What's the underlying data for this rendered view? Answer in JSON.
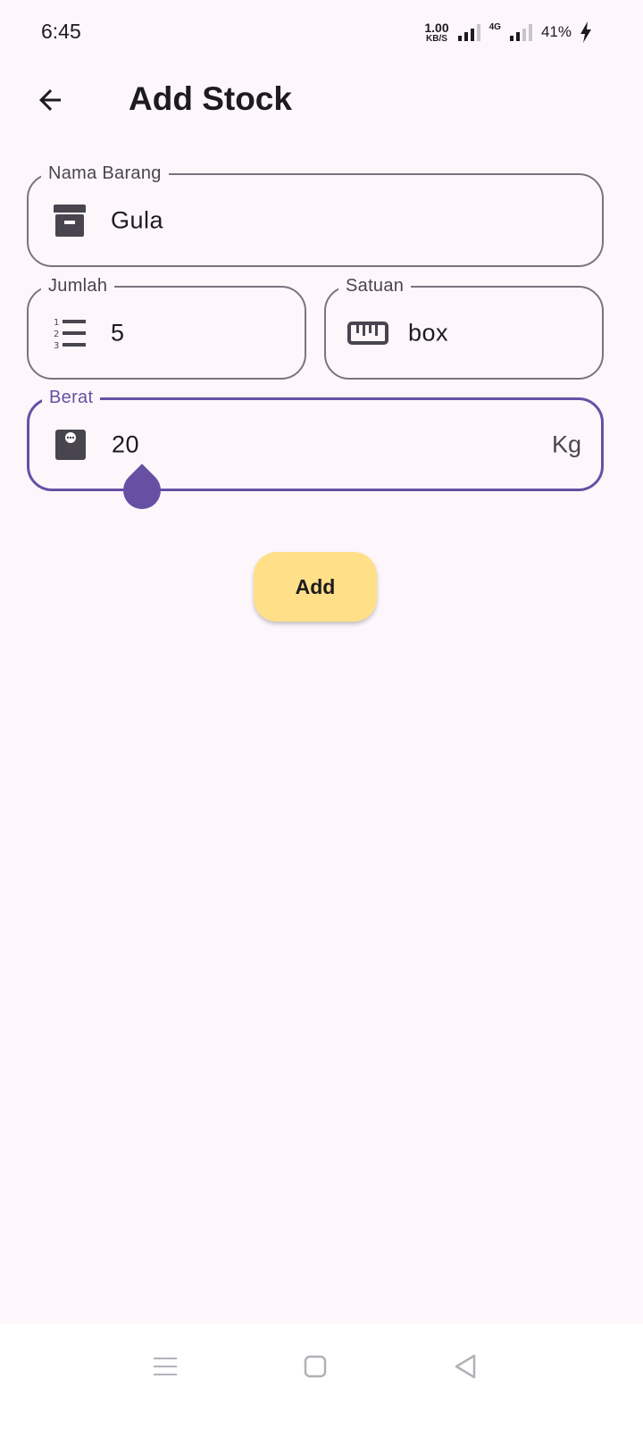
{
  "status_bar": {
    "time": "6:45",
    "net_speed_value": "1.00",
    "net_speed_unit": "KB/S",
    "network_type": "4G",
    "battery": "41%"
  },
  "app_bar": {
    "back_icon": "arrow-back-icon",
    "title": "Add Stock"
  },
  "form": {
    "nama_barang": {
      "label": "Nama Barang",
      "value": "Gula",
      "icon": "archive-box-icon"
    },
    "jumlah": {
      "label": "Jumlah",
      "value": "5",
      "icon": "numbered-list-icon"
    },
    "satuan": {
      "label": "Satuan",
      "value": "box",
      "icon": "ruler-icon"
    },
    "berat": {
      "label": "Berat",
      "value": "20",
      "suffix": "Kg",
      "icon": "scale-icon",
      "focused": true
    }
  },
  "add_button": {
    "label": "Add"
  },
  "nav_bar": {
    "items": [
      "menu-icon",
      "home-square-icon",
      "back-triangle-icon"
    ]
  },
  "colors": {
    "background": "#fdf7fc",
    "primary": "#6750a4",
    "outline": "#79747e",
    "button": "#ffdf88"
  }
}
